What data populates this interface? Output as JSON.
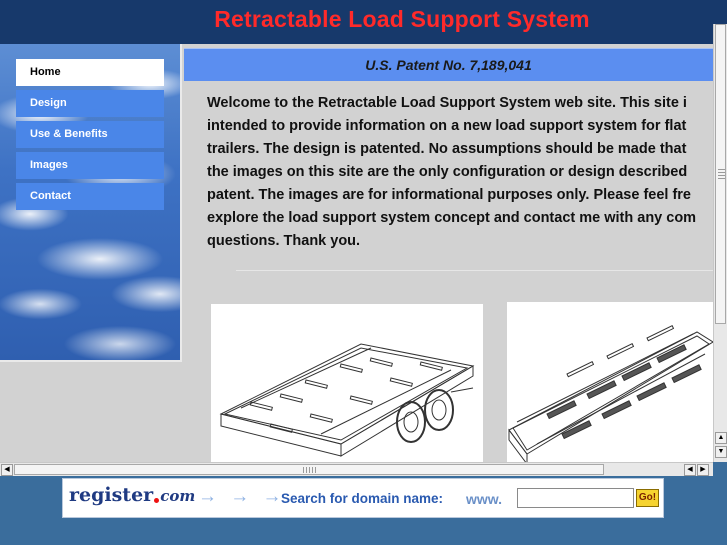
{
  "header": {
    "title": "Retractable Load Support System"
  },
  "nav": {
    "items": [
      {
        "label": "Home",
        "active": true
      },
      {
        "label": "Design",
        "active": false
      },
      {
        "label": "Use & Benefits",
        "active": false
      },
      {
        "label": "Images",
        "active": false
      },
      {
        "label": "Contact",
        "active": false
      }
    ]
  },
  "patent": {
    "text": "U.S. Patent No. 7,189,041"
  },
  "welcome": {
    "lines": [
      "Welcome to the Retractable Load Support System web site. This site i",
      "intended to provide information on a new load support system for flat",
      "trailers. The design is patented. No assumptions should be made that",
      "the images on this site are the only configuration or design described",
      "patent. The images are for informational purposes only. Please feel fre",
      "explore the load support system concept and contact me with any com",
      "questions. Thank you."
    ]
  },
  "images": {
    "left_icon": "trailer-drawing",
    "right_icon": "trailer-drawing"
  },
  "banner": {
    "logo_main": "register",
    "logo_com": "com",
    "arrows": "→ → →",
    "search_label": "Search for domain name:",
    "www": "www.",
    "input_value": "",
    "go_label": "Go!"
  },
  "colors": {
    "header_bg": "#17396b",
    "title_red": "#ff2a2a",
    "nav_blue": "#4a86e8",
    "patent_bar": "#5b8ef0",
    "content_bg": "#d2d2d2",
    "outer_bg": "#3a6d9c"
  }
}
